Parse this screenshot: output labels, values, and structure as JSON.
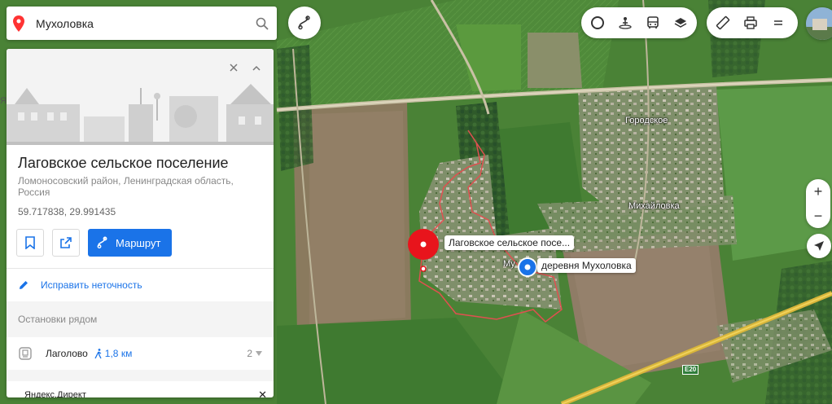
{
  "search": {
    "value": "Мухоловка"
  },
  "card": {
    "title": "Лаговское сельское поселение",
    "subtitle": "Ломоносовский район, Ленинградская область, Россия",
    "coordinates": "59.717838, 29.991435",
    "route_label": "Маршрут",
    "fix_label": "Исправить неточность",
    "stops_heading": "Остановки рядом",
    "stop": {
      "name": "Лаголово",
      "distance": "1,8 км",
      "count": "2"
    },
    "ad_label": "Яндекс.Директ"
  },
  "map": {
    "labels": {
      "gorodskoe": "Городское",
      "mikhailovka": "Михайловка",
      "mu_partial": "Му",
      "edge_letter": "Я"
    },
    "road_badge": "E20",
    "pin_red_label": "Лаговское сельское посе...",
    "pin_blue_label": "деревня Мухоловка"
  },
  "colors": {
    "accent_blue": "#1a73e8",
    "pin_red": "#e8141c",
    "boundary": "#e05050",
    "road_yellow": "#e6c23a"
  },
  "icons": [
    "yandex-maps-pin-icon",
    "search-icon",
    "route-icon",
    "close-icon",
    "collapse-icon",
    "bookmark-icon",
    "share-icon",
    "edit-icon",
    "bus-stop-icon",
    "walk-icon",
    "chevron-down-icon",
    "traffic-icon",
    "panorama-icon",
    "transport-icon",
    "layers-icon",
    "ruler-icon",
    "print-icon",
    "menu-icon",
    "zoom-in-icon",
    "zoom-out-icon",
    "geolocation-icon"
  ]
}
